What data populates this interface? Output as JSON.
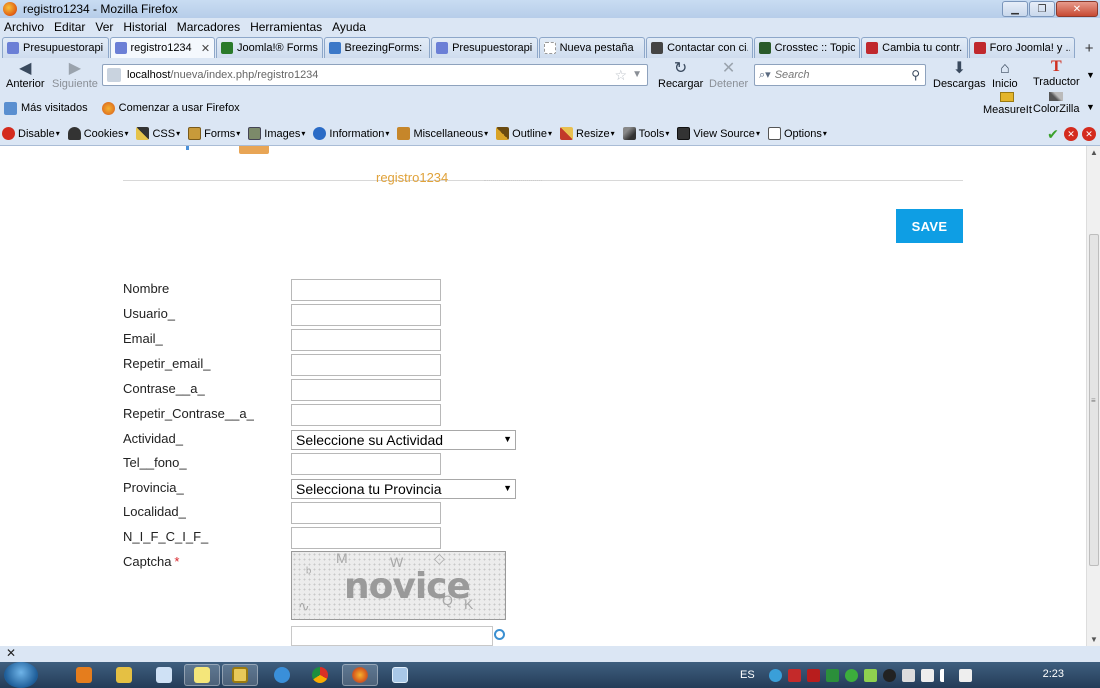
{
  "window": {
    "title": "registro1234 - Mozilla Firefox"
  },
  "menubar": [
    "Archivo",
    "Editar",
    "Ver",
    "Historial",
    "Marcadores",
    "Herramientas",
    "Ayuda"
  ],
  "tabs": [
    {
      "label": "Presupuestorapi...",
      "color": "#6b7fd6"
    },
    {
      "label": "registro1234",
      "color": "#6b7fd6",
      "active": true
    },
    {
      "label": "Joomla!® Forms...",
      "color": "#2a7a2a"
    },
    {
      "label": "BreezingForms: ...",
      "color": "#3b78c8"
    },
    {
      "label": "Presupuestorapi...",
      "color": "#6b7fd6"
    },
    {
      "label": "Nueva pestaña",
      "color": "#cccccc"
    },
    {
      "label": "Contactar con ci...",
      "color": "#444444"
    },
    {
      "label": "Crosstec :: Topic...",
      "color": "#2a5a2a"
    },
    {
      "label": "Cambia tu contr...",
      "color": "#c0282d"
    },
    {
      "label": "Foro Joomla! y ...",
      "color": "#c0282d"
    }
  ],
  "nav": {
    "back": "Anterior",
    "forward": "Siguiente",
    "reload": "Recargar",
    "stop": "Detener",
    "downloads": "Descargas",
    "home": "Inicio",
    "translator": "Traductor",
    "url_host": "localhost",
    "url_path": "/nueva/index.php/registro1234",
    "search_placeholder": "Search"
  },
  "bookmarks": [
    "Más visitados",
    "Comenzar a usar Firefox"
  ],
  "bookmarks_right": [
    "MeasureIt",
    "ColorZilla"
  ],
  "devbar": [
    "Disable",
    "Cookies",
    "CSS",
    "Forms",
    "Images",
    "Information",
    "Miscellaneous",
    "Outline",
    "Resize",
    "Tools",
    "View Source",
    "Options"
  ],
  "page": {
    "heading": "registro1234",
    "save_label": "SAVE",
    "fields": [
      {
        "label": "Nombre",
        "type": "text"
      },
      {
        "label": "Usuario_",
        "type": "text"
      },
      {
        "label": "Email_",
        "type": "text"
      },
      {
        "label": "Repetir_email_",
        "type": "text"
      },
      {
        "label": "Contrase__a_",
        "type": "text"
      },
      {
        "label": "Repetir_Contrase__a_",
        "type": "text"
      },
      {
        "label": "Actividad_",
        "type": "select",
        "value": "Seleccione su Actividad"
      },
      {
        "label": "Tel__fono_",
        "type": "text"
      },
      {
        "label": "Provincia_",
        "type": "select",
        "value": "Selecciona tu Provincia"
      },
      {
        "label": "Localidad_",
        "type": "text"
      },
      {
        "label": "N_I_F_C_I_F_",
        "type": "text"
      }
    ],
    "captcha_label": "Captcha",
    "captcha_required": "*",
    "captcha_word": "novice"
  },
  "taskbar": {
    "language": "ES",
    "clock": "2:23"
  },
  "colors": {
    "save_button": "#0e9ee4",
    "heading": "#e0a23a",
    "required": "#d9262c"
  }
}
